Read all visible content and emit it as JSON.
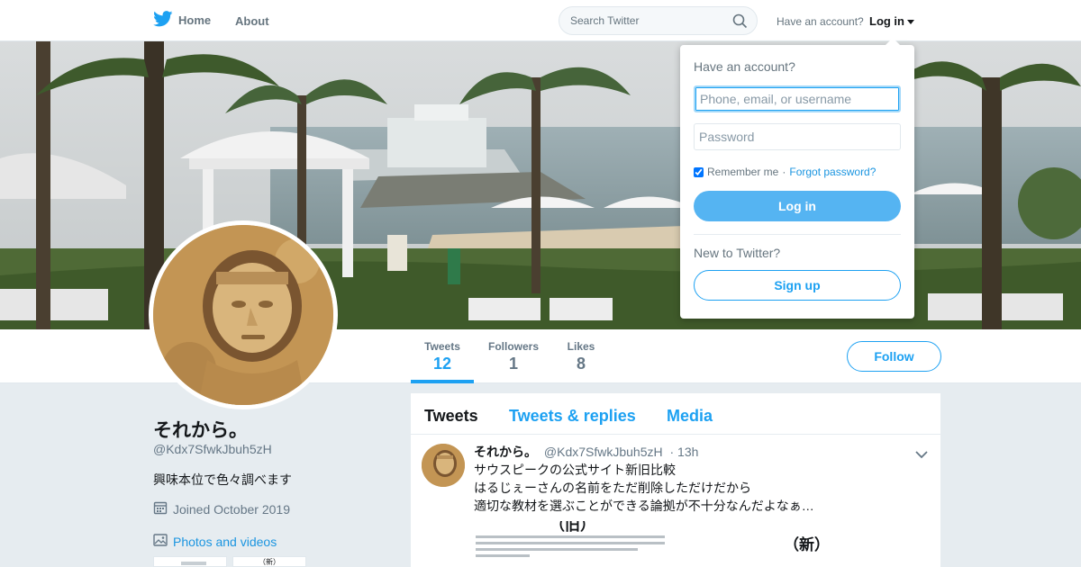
{
  "nav": {
    "home_label": "Home",
    "about_label": "About",
    "search_placeholder": "Search Twitter",
    "have_account": "Have an account?",
    "login_label": "Log in",
    "brand_color": "#1da1f2"
  },
  "profile_nav": {
    "stats": [
      {
        "label": "Tweets",
        "value": "12"
      },
      {
        "label": "Followers",
        "value": "1"
      },
      {
        "label": "Likes",
        "value": "8"
      }
    ],
    "follow_label": "Follow"
  },
  "profile": {
    "name": "それから。",
    "handle": "@Kdx7SfwkJbuh5zH",
    "bio": "興味本位で色々調べます",
    "joined": "Joined October 2019",
    "photos_label": "Photos and videos"
  },
  "timeline": {
    "tabs": [
      "Tweets",
      "Tweets & replies",
      "Media"
    ],
    "tweet": {
      "name": "それから。",
      "handle": "@Kdx7SfwkJbuh5zH",
      "time": "· 13h",
      "lines": [
        "サウスピークの公式サイト新旧比較",
        "はるじぇーさんの名前をただ削除しただけだから",
        "適切な教材を選ぶことができる論拠が不十分なんだよなぁ…"
      ],
      "media_label_old": "（旧）",
      "media_label_new": "（新）",
      "thumb_label": "（新）"
    }
  },
  "login_dropdown": {
    "title": "Have an account?",
    "username_placeholder": "Phone, email, or username",
    "password_placeholder": "Password",
    "remember_label": "Remember me",
    "separator": "·",
    "forgot_label": "Forgot password?",
    "login_button": "Log in",
    "new_label": "New to Twitter?",
    "signup_button": "Sign up"
  }
}
